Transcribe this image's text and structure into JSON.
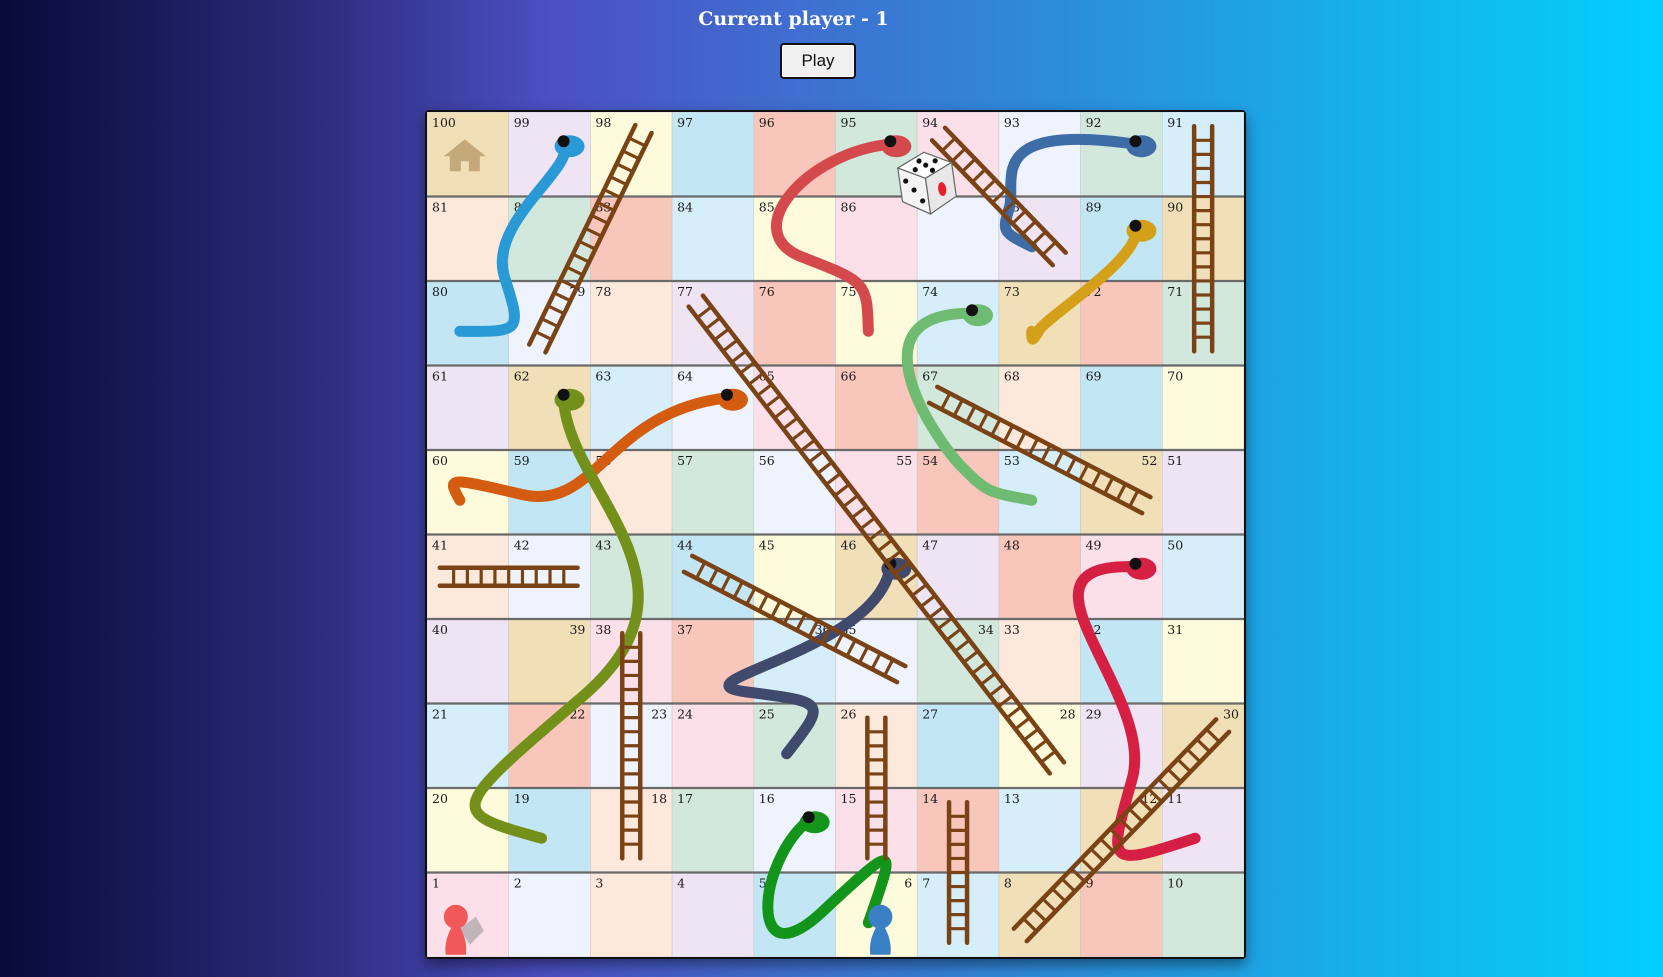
{
  "status": {
    "text": "Current player - 1"
  },
  "controls": {
    "play_label": "Play"
  },
  "board": {
    "cells": [
      "100",
      "99",
      "98",
      "97",
      "96",
      "95",
      "94",
      "93",
      "92",
      "91",
      "81",
      "82",
      "83",
      "84",
      "85",
      "86",
      "87",
      "88",
      "89",
      "90",
      "80",
      "79",
      "78",
      "77",
      "76",
      "75",
      "74",
      "73",
      "72",
      "71",
      "61",
      "62",
      "63",
      "64",
      "65",
      "66",
      "67",
      "68",
      "69",
      "70",
      "60",
      "59",
      "58",
      "57",
      "56",
      "55",
      "54",
      "53",
      "52",
      "51",
      "41",
      "42",
      "43",
      "44",
      "45",
      "46",
      "47",
      "48",
      "49",
      "50",
      "40",
      "39",
      "38",
      "37",
      "36",
      "35",
      "34",
      "33",
      "32",
      "31",
      "21",
      "22",
      "23",
      "24",
      "25",
      "26",
      "27",
      "28",
      "29",
      "30",
      "20",
      "19",
      "18",
      "17",
      "16",
      "15",
      "14",
      "13",
      "12",
      "11",
      "1",
      "2",
      "3",
      "4",
      "5",
      "6",
      "7",
      "8",
      "9",
      "10"
    ],
    "cell_colors": [
      "#f1dfb8",
      "#eee4f4",
      "#fefbdd",
      "#c3e6f5",
      "#f8c6ba",
      "#d2e8dc",
      "#fbe0ea",
      "#eef3fd",
      "#d2e8dc",
      "#d6eefa",
      "#fde9dc",
      "#d2e8dc",
      "#f8c6ba",
      "#d6eefa",
      "#fefbdd",
      "#fbe0ea",
      "#eef3fd",
      "#eee4f4",
      "#c3e6f5",
      "#f1dfb8",
      "#c3e6f5",
      "#eef3fd",
      "#fde9dc",
      "#eee4f4",
      "#f8c6ba",
      "#fefbdd",
      "#d6eefa",
      "#f1dfb8",
      "#f8c6ba",
      "#d2e8dc",
      "#eee4f4",
      "#f1dfb8",
      "#d6eefa",
      "#eef3fd",
      "#fbe0ea",
      "#f8c6ba",
      "#d2e8dc",
      "#fde9dc",
      "#c3e6f5",
      "#fefbdd",
      "#fefbdd",
      "#c3e6f5",
      "#fde9dc",
      "#d2e8dc",
      "#eef3fd",
      "#fbe0ea",
      "#f8c6ba",
      "#d6eefa",
      "#f1dfb8",
      "#eee4f4",
      "#fde9dc",
      "#eef3fd",
      "#d2e8dc",
      "#c3e6f5",
      "#fefbdd",
      "#f1dfb8",
      "#eee4f4",
      "#f8c6ba",
      "#fbe0ea",
      "#d6eefa",
      "#eee4f4",
      "#f1dfb8",
      "#fbe0ea",
      "#f8c6ba",
      "#d6eefa",
      "#eef3fd",
      "#d2e8dc",
      "#fde9dc",
      "#c3e6f5",
      "#fefbdd",
      "#d6eefa",
      "#f8c6ba",
      "#eef3fd",
      "#fbe0ea",
      "#d2e8dc",
      "#fde9dc",
      "#c3e6f5",
      "#fefbdd",
      "#eee4f4",
      "#f1dfb8",
      "#fefbdd",
      "#c3e6f5",
      "#fde9dc",
      "#d2e8dc",
      "#eef3fd",
      "#fbe0ea",
      "#f8c6ba",
      "#d6eefa",
      "#f1dfb8",
      "#eee4f4",
      "#fbe0ea",
      "#eef3fd",
      "#fde9dc",
      "#eee4f4",
      "#c3e6f5",
      "#fefbdd",
      "#d6eefa",
      "#f1dfb8",
      "#f8c6ba",
      "#d2e8dc"
    ],
    "right_aligned_labels": [
      "79",
      "55",
      "52",
      "39",
      "36",
      "34",
      "22",
      "23",
      "28",
      "30",
      "18",
      "12",
      "6"
    ],
    "home_square": "100",
    "home_icon": "house-icon",
    "dice": {
      "face_value": 5,
      "icon": "dice-icon"
    },
    "ladders": [
      {
        "from": "79",
        "to": "98"
      },
      {
        "from": "88",
        "to": "94"
      },
      {
        "from": "71",
        "to": "91"
      },
      {
        "from": "28",
        "to": "77"
      },
      {
        "from": "52",
        "to": "67"
      },
      {
        "from": "41",
        "to": "42"
      },
      {
        "from": "35",
        "to": "44"
      },
      {
        "from": "18",
        "to": "38"
      },
      {
        "from": "15",
        "to": "26"
      },
      {
        "from": "7",
        "to": "14"
      },
      {
        "from": "8",
        "to": "30"
      }
    ],
    "snakes": [
      {
        "head": "99",
        "tail": "80",
        "color": "#2a9ad6"
      },
      {
        "head": "95",
        "tail": "75",
        "color": "#d44a4c"
      },
      {
        "head": "92",
        "tail": "88",
        "color": "#3d6ca6"
      },
      {
        "head": "89",
        "tail": "73",
        "color": "#d4a019"
      },
      {
        "head": "74",
        "tail": "53",
        "color": "#6fbb72"
      },
      {
        "head": "64",
        "tail": "60",
        "color": "#d45c10"
      },
      {
        "head": "62",
        "tail": "19",
        "color": "#73901b"
      },
      {
        "head": "46",
        "tail": "25",
        "color": "#404a6c"
      },
      {
        "head": "49",
        "tail": "11",
        "color": "#d51f43"
      },
      {
        "head": "16",
        "tail": "6",
        "color": "#13951b"
      }
    ],
    "tokens": [
      {
        "player": "1",
        "square": "1",
        "color": "#f0585a",
        "icon": "player-1-token-icon"
      },
      {
        "player": "2",
        "square": "6",
        "color": "#3a80c4",
        "icon": "player-2-token-icon"
      }
    ]
  }
}
